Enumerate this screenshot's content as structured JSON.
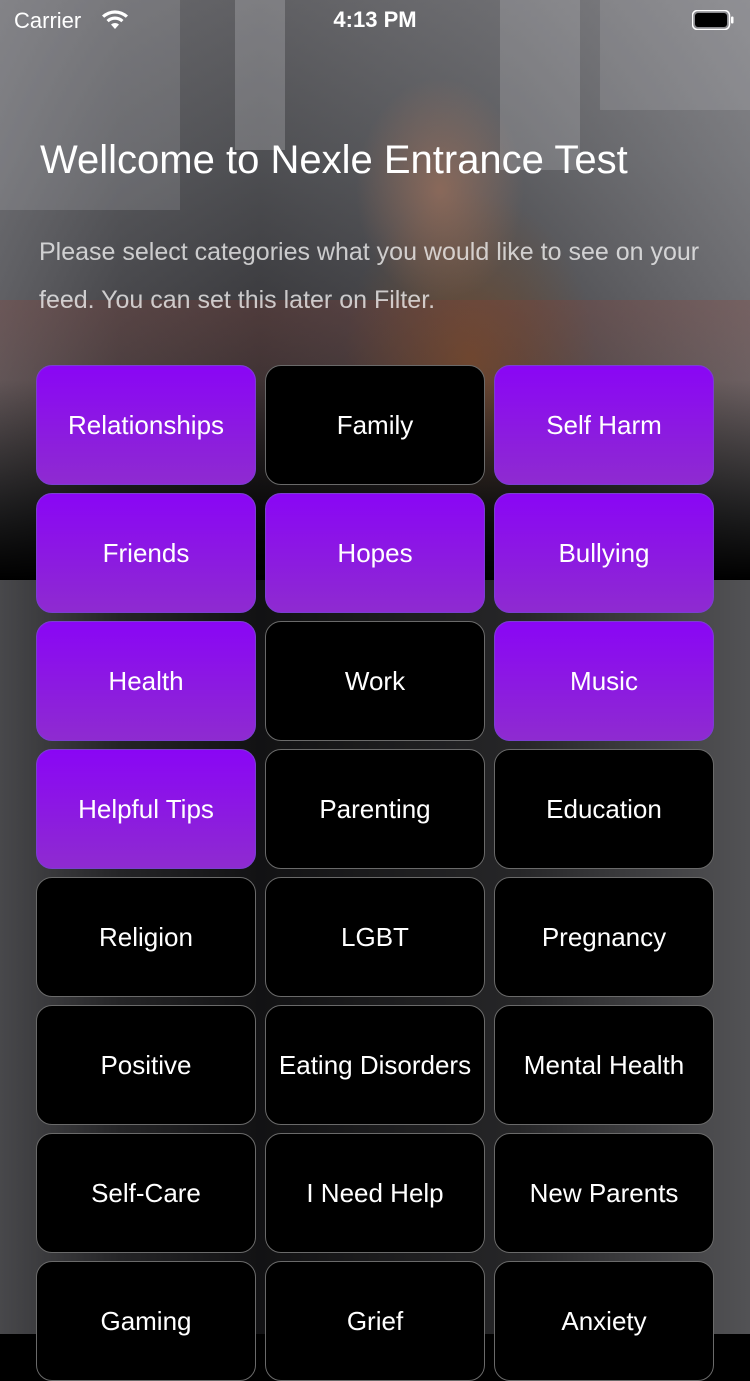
{
  "status_bar": {
    "carrier": "Carrier",
    "time": "4:13 PM",
    "wifi_icon": "wifi-icon",
    "battery_icon": "battery-icon"
  },
  "header": {
    "title": "Wellcome to Nexle Entrance Test",
    "subtitle": "Please select categories what you would like to see on your feed. You can set this later on Filter."
  },
  "colors": {
    "selected_top": "#8a06f5",
    "selected_bottom": "#8e2bd0",
    "unselected_bg": "#000000",
    "border": "#6a6a6a"
  },
  "categories": [
    {
      "label": "Relationships",
      "selected": true
    },
    {
      "label": "Family",
      "selected": false
    },
    {
      "label": "Self Harm",
      "selected": true
    },
    {
      "label": "Friends",
      "selected": true
    },
    {
      "label": "Hopes",
      "selected": true
    },
    {
      "label": "Bullying",
      "selected": true
    },
    {
      "label": "Health",
      "selected": true
    },
    {
      "label": "Work",
      "selected": false
    },
    {
      "label": "Music",
      "selected": true
    },
    {
      "label": "Helpful Tips",
      "selected": true
    },
    {
      "label": "Parenting",
      "selected": false
    },
    {
      "label": "Education",
      "selected": false
    },
    {
      "label": "Religion",
      "selected": false
    },
    {
      "label": "LGBT",
      "selected": false
    },
    {
      "label": "Pregnancy",
      "selected": false
    },
    {
      "label": "Positive",
      "selected": false
    },
    {
      "label": "Eating Disorders",
      "selected": false
    },
    {
      "label": "Mental Health",
      "selected": false
    },
    {
      "label": "Self-Care",
      "selected": false
    },
    {
      "label": "I Need Help",
      "selected": false
    },
    {
      "label": "New Parents",
      "selected": false
    },
    {
      "label": "Gaming",
      "selected": false
    },
    {
      "label": "Grief",
      "selected": false
    },
    {
      "label": "Anxiety",
      "selected": false
    }
  ]
}
